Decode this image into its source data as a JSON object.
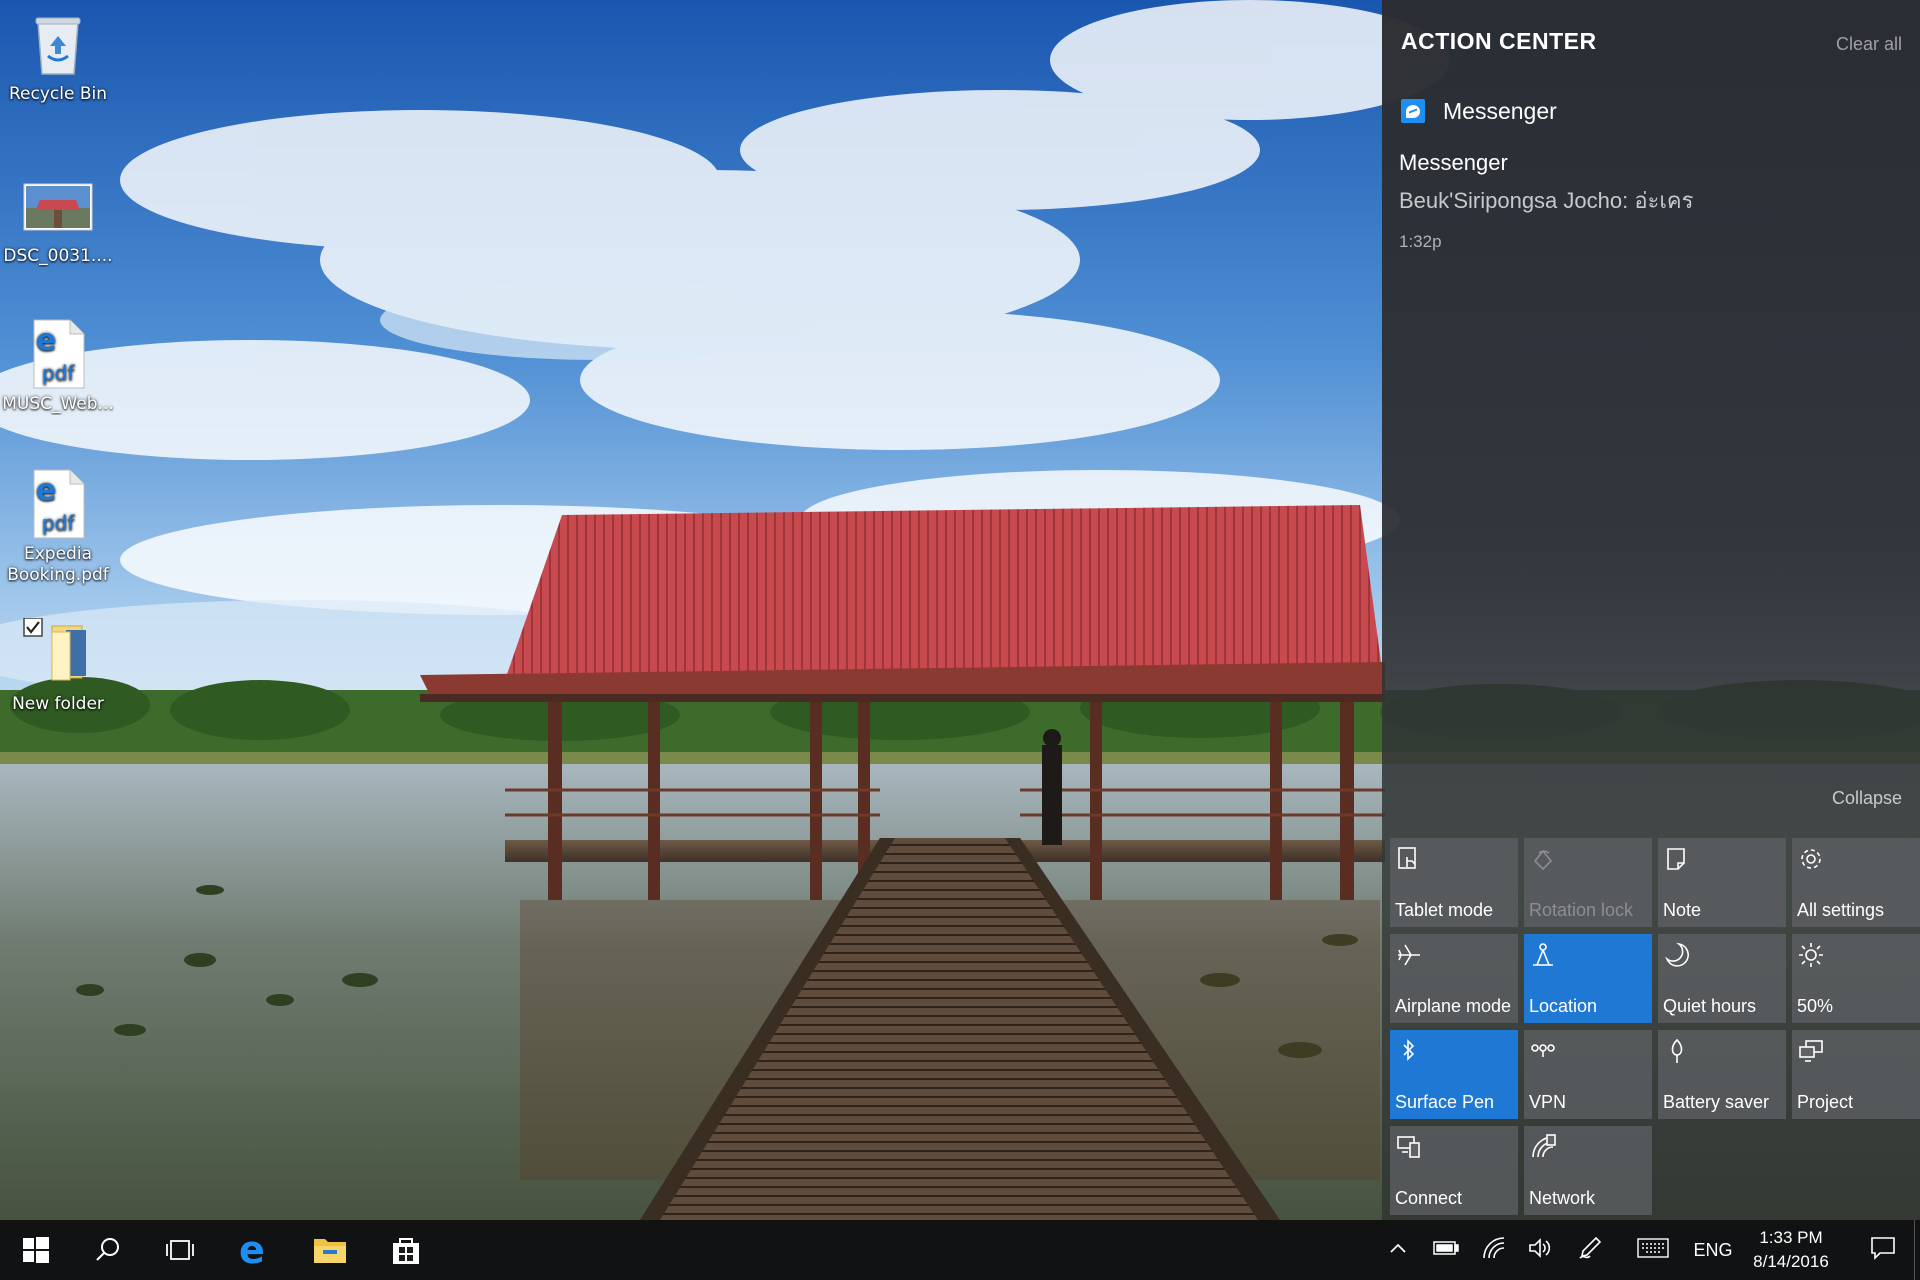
{
  "desktop": {
    "icons": [
      {
        "label": "Recycle Bin",
        "icon": "recycle-bin-icon"
      },
      {
        "label": "DSC_0031....",
        "icon": "image-thumbnail-icon"
      },
      {
        "label": "MUSC_Web...",
        "icon": "edge-pdf-icon"
      },
      {
        "label": "Expedia Booking.pdf",
        "icon": "edge-pdf-icon"
      },
      {
        "label": "New folder",
        "icon": "folder-icon",
        "checked": true
      }
    ]
  },
  "action_center": {
    "title": "ACTION CENTER",
    "clear_all": "Clear all",
    "notification": {
      "app_name": "Messenger",
      "title": "Messenger",
      "body": "Beuk'Siripongsa Jocho: อ่ะเคร",
      "time": "1:32p"
    },
    "collapse": "Collapse",
    "tiles": [
      {
        "label": "Tablet mode",
        "icon": "tablet-mode-icon",
        "state": "off"
      },
      {
        "label": "Rotation lock",
        "icon": "rotation-lock-icon",
        "state": "disabled"
      },
      {
        "label": "Note",
        "icon": "note-icon",
        "state": "off"
      },
      {
        "label": "All settings",
        "icon": "gear-icon",
        "state": "off"
      },
      {
        "label": "Airplane mode",
        "icon": "airplane-icon",
        "state": "off"
      },
      {
        "label": "Location",
        "icon": "location-icon",
        "state": "on"
      },
      {
        "label": "Quiet hours",
        "icon": "moon-icon",
        "state": "off"
      },
      {
        "label": "50%",
        "icon": "brightness-icon",
        "state": "off"
      },
      {
        "label": "Surface Pen",
        "icon": "bluetooth-icon",
        "state": "on"
      },
      {
        "label": "VPN",
        "icon": "vpn-icon",
        "state": "off"
      },
      {
        "label": "Battery saver",
        "icon": "battery-saver-icon",
        "state": "off"
      },
      {
        "label": "Project",
        "icon": "project-icon",
        "state": "off"
      },
      {
        "label": "Connect",
        "icon": "connect-icon",
        "state": "off"
      },
      {
        "label": "Network",
        "icon": "network-icon",
        "state": "off"
      }
    ]
  },
  "taskbar": {
    "language": "ENG",
    "time": "1:33 PM",
    "date": "8/14/2016",
    "pinned": [
      "start-icon",
      "search-icon",
      "task-view-icon",
      "edge-icon",
      "file-explorer-icon",
      "store-icon"
    ],
    "accent": "#1e78d4"
  }
}
